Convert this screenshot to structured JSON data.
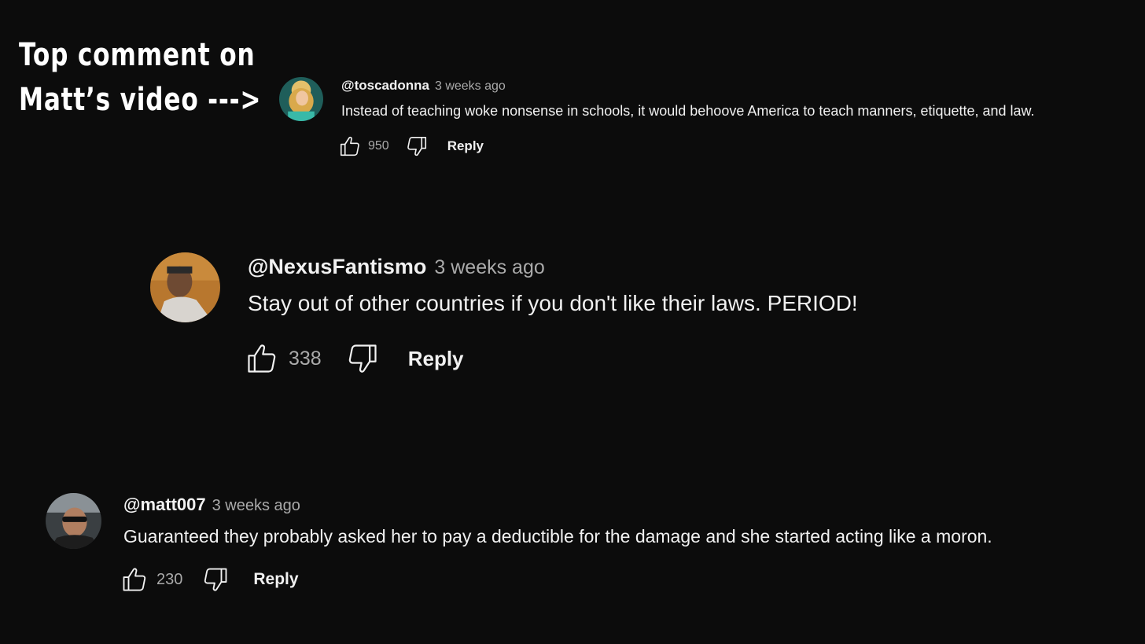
{
  "annotation": {
    "line1": "Top comment on",
    "line2": "Matt’s video --->"
  },
  "comments": [
    {
      "handle": "@toscadonna",
      "time": "3 weeks ago",
      "text": "Instead of teaching woke nonsense in schools, it would behoove America to teach manners, etiquette, and law.",
      "likes": "950",
      "reply_label": "Reply"
    },
    {
      "handle": "@NexusFantismo",
      "time": "3 weeks ago",
      "text": "Stay out of other countries if you don't like their laws. PERIOD!",
      "likes": "338",
      "reply_label": "Reply"
    },
    {
      "handle": "@matt007",
      "time": "3 weeks ago",
      "text": "Guaranteed they probably asked her to pay a deductible for the damage and she started acting like a moron.",
      "likes": "230",
      "reply_label": "Reply"
    }
  ],
  "icons": {
    "like": "thumbs-up-icon",
    "dislike": "thumbs-down-icon"
  },
  "colors": {
    "background": "#0c0c0c",
    "text": "#f1f1f1",
    "secondary_text": "#aaaaaa"
  }
}
